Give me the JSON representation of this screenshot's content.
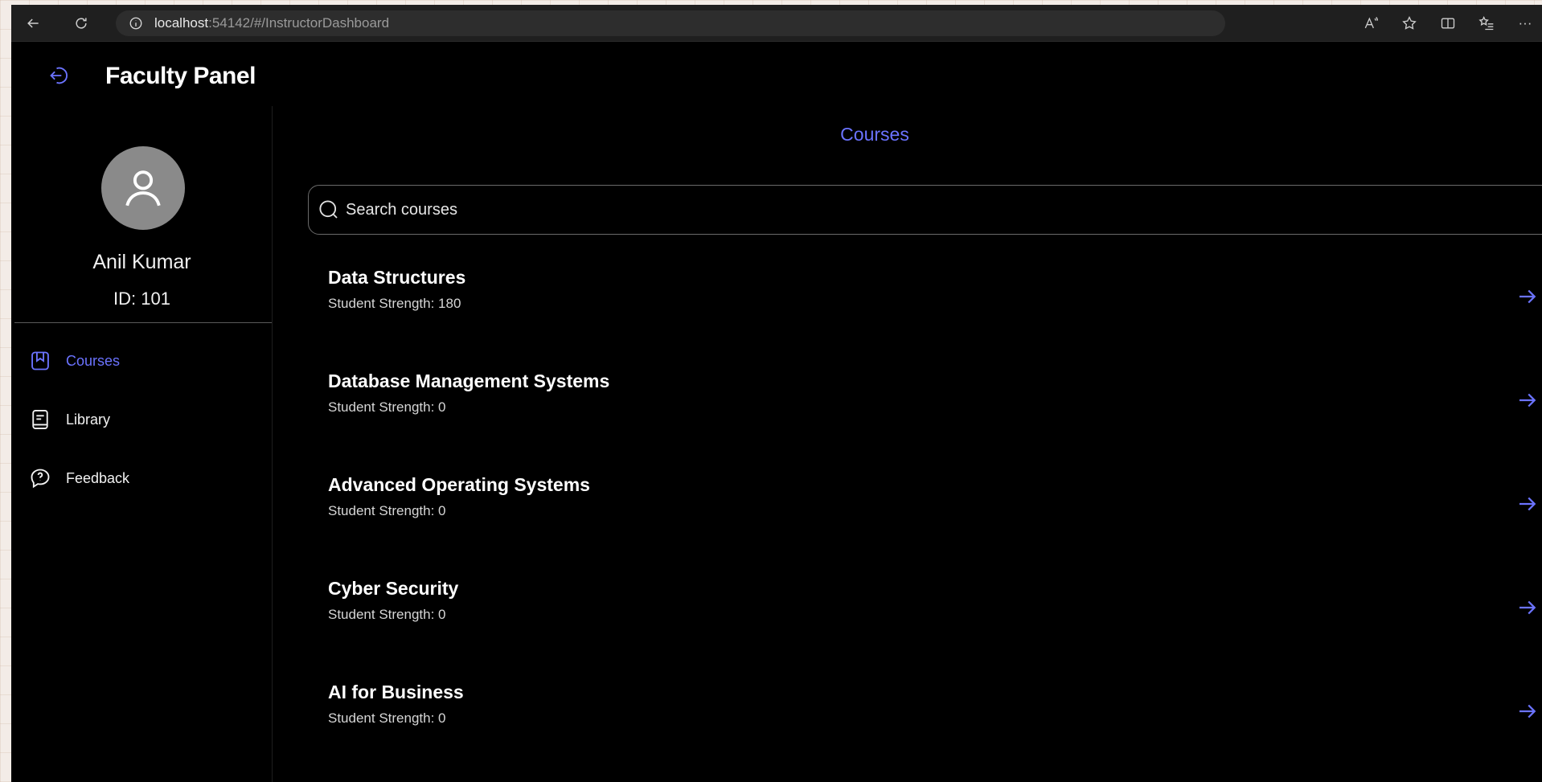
{
  "browser": {
    "url_host": "localhost",
    "url_path": ":54142/#/InstructorDashboard",
    "more_label": "···"
  },
  "app": {
    "title": "Faculty Panel"
  },
  "profile": {
    "name": "Anil Kumar",
    "id_text": "ID: 101"
  },
  "sidebar": {
    "items": [
      {
        "label": "Courses",
        "icon": "bookmark-icon",
        "active": true
      },
      {
        "label": "Library",
        "icon": "book-icon",
        "active": false
      },
      {
        "label": "Feedback",
        "icon": "feedback-icon",
        "active": false
      }
    ]
  },
  "main": {
    "section_title": "Courses",
    "search_placeholder": "Search courses",
    "courses": [
      {
        "title": "Data Structures",
        "subtitle": "Student Strength: 180"
      },
      {
        "title": "Database Management Systems",
        "subtitle": "Student Strength: 0"
      },
      {
        "title": "Advanced Operating Systems",
        "subtitle": "Student Strength: 0"
      },
      {
        "title": "Cyber Security",
        "subtitle": "Student Strength: 0"
      },
      {
        "title": "AI for Business",
        "subtitle": "Student Strength: 0"
      }
    ]
  },
  "colors": {
    "accent": "#6b73ff",
    "background": "#000000",
    "text": "#ffffff"
  }
}
